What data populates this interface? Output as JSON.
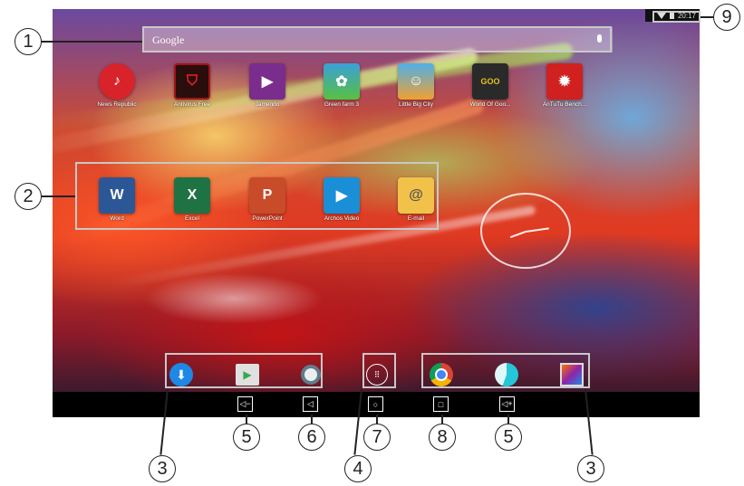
{
  "status": {
    "time": "20:17"
  },
  "search": {
    "placeholder": "Google"
  },
  "home_apps": [
    {
      "label": "News Republic",
      "icon": "news-republic-icon",
      "color": "#d8232a"
    },
    {
      "label": "Antivirus Free",
      "icon": "antivirus-shield-icon",
      "color": "#a01418"
    },
    {
      "label": "Jamendo",
      "icon": "jamendo-play-icon",
      "color": "#7a2d8c"
    },
    {
      "label": "Green farm 3",
      "icon": "green-farm-icon",
      "color": "#3aa0d8"
    },
    {
      "label": "Little Big City",
      "icon": "little-big-city-icon",
      "color": "#f0a030"
    },
    {
      "label": "World Of Goo...",
      "icon": "world-of-goo-icon",
      "color": "#e8c020"
    },
    {
      "label": "AnTuTu Bench...",
      "icon": "antutu-icon",
      "color": "#d02020"
    }
  ],
  "favorites": [
    {
      "label": "Word",
      "icon": "word-icon",
      "letter": "W",
      "color": "#2b5797"
    },
    {
      "label": "Excel",
      "icon": "excel-icon",
      "letter": "X",
      "color": "#1f7244"
    },
    {
      "label": "PowerPoint",
      "icon": "powerpoint-icon",
      "letter": "P",
      "color": "#c84b2a"
    },
    {
      "label": "Archos Video",
      "icon": "archos-video-icon",
      "letter": "▶",
      "color": "#1a8fd8"
    },
    {
      "label": "E-mail",
      "icon": "email-icon",
      "letter": "@",
      "color": "#f2c14a"
    }
  ],
  "dock": [
    {
      "icon": "download-icon",
      "color": "#1e88e5"
    },
    {
      "icon": "play-store-icon",
      "color": "#e0e0e0"
    },
    {
      "icon": "camera-icon",
      "color": "#607d8b"
    },
    {
      "icon": "app-drawer-icon",
      "color": "#ffffff"
    },
    {
      "icon": "chrome-icon",
      "color": "#db4437"
    },
    {
      "icon": "photos-icon",
      "color": "#26c6da"
    },
    {
      "icon": "gallery-icon",
      "color": "#8e24aa"
    }
  ],
  "navbar": {
    "vol_down": "◁−",
    "back": "◁",
    "home": "○",
    "recent": "□",
    "vol_up": "◁+"
  },
  "callouts": [
    "1",
    "2",
    "3",
    "3",
    "4",
    "5",
    "5",
    "6",
    "7",
    "8",
    "9"
  ]
}
